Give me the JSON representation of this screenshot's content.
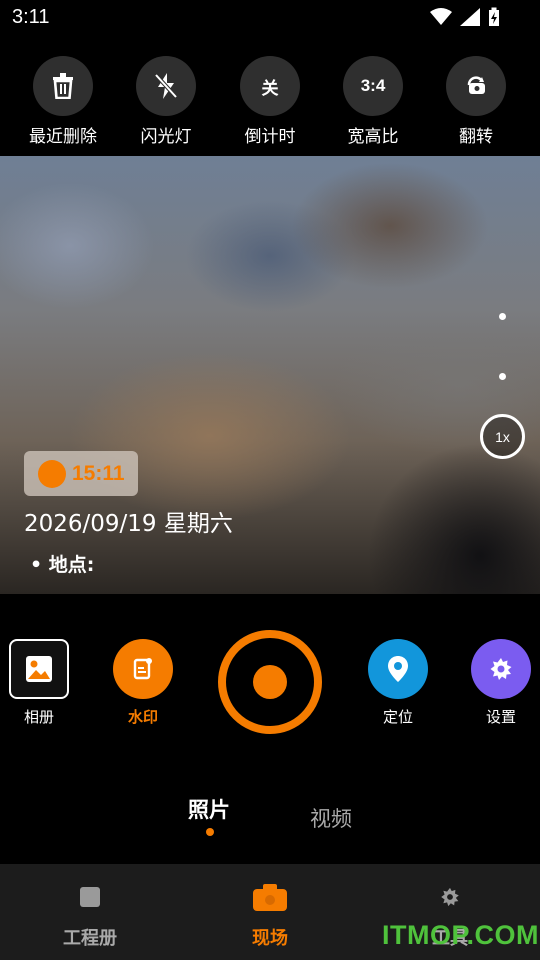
{
  "status_bar": {
    "time": "3:11"
  },
  "top_tools": [
    {
      "label": "最近删除",
      "icon": "trash-icon"
    },
    {
      "label": "闪光灯",
      "icon": "flash-off-icon"
    },
    {
      "label": "倒计时",
      "icon_text": "关"
    },
    {
      "label": "宽高比",
      "icon_text": "3:4"
    },
    {
      "label": "翻转",
      "icon": "flip-camera-icon"
    }
  ],
  "preview": {
    "zoom": "1x",
    "watermark": {
      "time": "15:11",
      "date": "2026/09/19 星期六",
      "location_label": "• 地点:"
    }
  },
  "controls": {
    "album_label": "相册",
    "watermark_label": "水印",
    "location_label": "定位",
    "settings_label": "设置"
  },
  "colors": {
    "accent": "#f57c00",
    "location": "#1296db",
    "settings": "#7b5cf0",
    "watermark_text": "#4fc23c"
  },
  "modes": {
    "photo": "照片",
    "video": "视频"
  },
  "bottom_nav": {
    "project": "工程册",
    "scene": "现场",
    "tools": "工具"
  },
  "site_watermark": "ITMOP.COM"
}
